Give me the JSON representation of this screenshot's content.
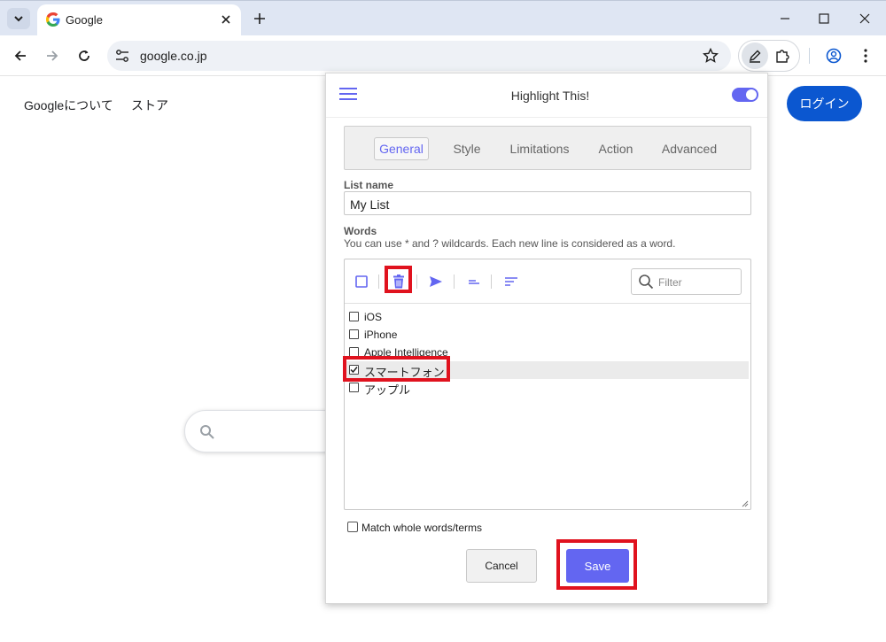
{
  "browser": {
    "tab": {
      "title": "Google"
    },
    "url": "google.co.jp"
  },
  "page": {
    "links": [
      "Googleについて",
      "ストア"
    ],
    "login_label": "ログイン"
  },
  "popup": {
    "title": "Highlight This!",
    "enabled": true,
    "tabs": [
      "General",
      "Style",
      "Limitations",
      "Action",
      "Advanced"
    ],
    "active_tab": "General",
    "list_name_label": "List name",
    "list_name_value": "My List",
    "words_label": "Words",
    "words_hint": "You can use * and ? wildcards. Each new line is considered as a word.",
    "filter_placeholder": "Filter",
    "words": [
      {
        "text": "iOS",
        "checked": false
      },
      {
        "text": "iPhone",
        "checked": false
      },
      {
        "text": "Apple Intelligence",
        "checked": false
      },
      {
        "text": "スマートフォン",
        "checked": true
      },
      {
        "text": "アップル",
        "checked": false
      }
    ],
    "match_whole_label": "Match whole words/terms",
    "match_whole_checked": false,
    "cancel_label": "Cancel",
    "save_label": "Save"
  },
  "colors": {
    "accent": "#6366f1",
    "google_blue": "#0b57d0",
    "highlight_box": "#e0121e"
  }
}
